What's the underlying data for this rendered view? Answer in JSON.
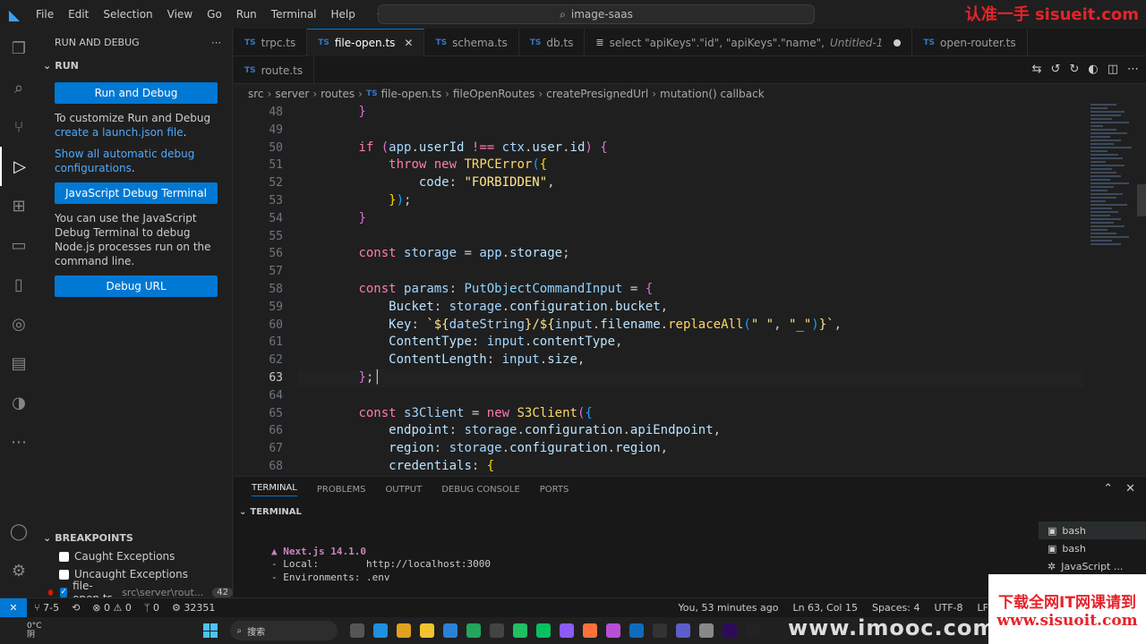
{
  "titlebar": {
    "menu": [
      "File",
      "Edit",
      "Selection",
      "View",
      "Go",
      "Run",
      "Terminal",
      "Help"
    ],
    "search": "image-saas",
    "watermark": "认准一手 sisueit.com"
  },
  "sidebar": {
    "title": "RUN AND DEBUG",
    "run_section": "RUN",
    "run_button": "Run and Debug",
    "customize_text": "To customize Run and Debug",
    "customize_link": "create a launch.json file",
    "customize_suffix": ".",
    "auto_debug_link": "Show all automatic debug configurations",
    "auto_debug_suffix": ".",
    "js_terminal_button": "JavaScript Debug Terminal",
    "js_terminal_text": "You can use the JavaScript Debug Terminal to debug Node.js processes run on the command line.",
    "debug_url_button": "Debug URL",
    "breakpoints_title": "BREAKPOINTS",
    "breakpoints": [
      {
        "label": "Caught Exceptions",
        "checked": false
      },
      {
        "label": "Uncaught Exceptions",
        "checked": false
      }
    ],
    "bp_file": {
      "label": "file-open.ts",
      "path": "src\\server\\rout...",
      "count": "42"
    }
  },
  "tabs": {
    "row1": [
      {
        "label": "trpc.ts",
        "kind": "TS"
      },
      {
        "label": "file-open.ts",
        "kind": "TS",
        "active": true
      },
      {
        "label": "schema.ts",
        "kind": "TS"
      },
      {
        "label": "db.ts",
        "kind": "TS"
      },
      {
        "label": "select \"apiKeys\".\"id\", \"apiKeys\".\"name\",",
        "kind": "DB",
        "extra": "Untitled-1"
      },
      {
        "label": "open-router.ts",
        "kind": "TS"
      }
    ],
    "row2": [
      {
        "label": "route.ts",
        "kind": "TS"
      }
    ]
  },
  "breadcrumbs": [
    "src",
    "server",
    "routes",
    "file-open.ts",
    "fileOpenRoutes",
    "createPresignedUrl",
    "mutation() callback"
  ],
  "editor": {
    "line_numbers": [
      "48",
      "49",
      "50",
      "51",
      "52",
      "53",
      "54",
      "55",
      "56",
      "57",
      "58",
      "59",
      "60",
      "61",
      "62",
      "63",
      "64",
      "65",
      "66",
      "67",
      "68"
    ],
    "current_line": "63"
  },
  "panel": {
    "tabs": [
      "TERMINAL",
      "PROBLEMS",
      "OUTPUT",
      "DEBUG CONSOLE",
      "PORTS"
    ],
    "terminal_title": "TERMINAL",
    "lines": [
      "▲ Next.js 14.1.0",
      "- Local:        http://localhost:3000",
      "- Environments: .env"
    ],
    "terminals": [
      "bash",
      "bash",
      "JavaScript ..."
    ]
  },
  "statusbar": {
    "branch": "7-5",
    "errors": "0",
    "warnings": "0",
    "ports": "0",
    "pid": "32351",
    "blame": "You, 53 minutes ago",
    "position": "Ln 63, Col 15",
    "spaces": "Spaces: 4",
    "encoding": "UTF-8",
    "eol": "LF"
  },
  "taskbar": {
    "temp": "0°C",
    "weather": "阴",
    "search": "搜索"
  },
  "promo": {
    "line1": "下载全网IT网课请到",
    "line2": "www.sisuoit.com",
    "bottom": "www.imooc.com"
  },
  "colors": {
    "accent": "#0078d4",
    "background": "#1f1f1f"
  }
}
